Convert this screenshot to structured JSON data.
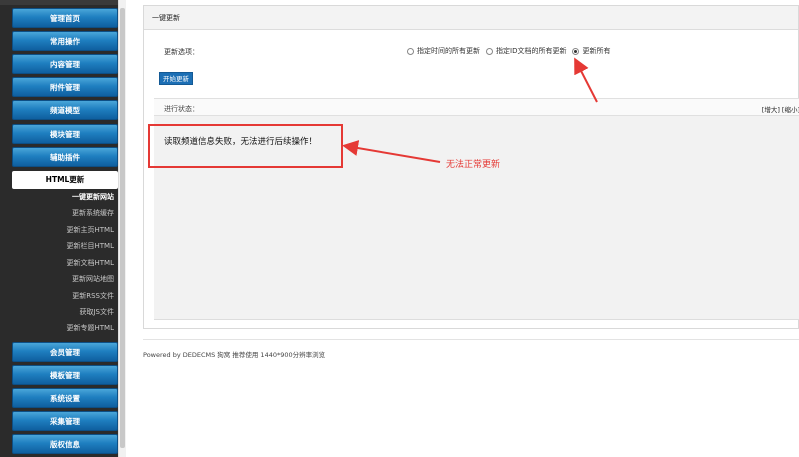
{
  "sidebar": {
    "buttons": {
      "home": "管理首页",
      "common": "常用操作",
      "content": "内容管理",
      "attach": "附件管理",
      "channel": "频道模型",
      "module": "模块管理",
      "plugin": "辅助插件",
      "member": "会员管理",
      "template": "模板管理",
      "system": "系统设置",
      "collect": "采集管理",
      "copyright": "版权信息"
    },
    "active": "HTML更新",
    "subitems": [
      "一键更新网站",
      "更新系统缓存",
      "更新主页HTML",
      "更新栏目HTML",
      "更新文档HTML",
      "更新网站地图",
      "更新RSS文件",
      "获取JS文件",
      "更新专题HTML"
    ]
  },
  "panel": {
    "title": "一键更新",
    "options_label": "更新选项：",
    "options": [
      {
        "label": "指定时间的所有更新",
        "selected": false
      },
      {
        "label": "指定ID文档的所有更新",
        "selected": false
      },
      {
        "label": "更新所有",
        "selected": true
      }
    ],
    "start_button": "开始更新",
    "progress_label": "进行状态：",
    "progress_tools": "[增大] [缩小]",
    "status_message": "读取频道信息失败，无法进行后续操作！"
  },
  "annotation": {
    "text": "无法正常更新",
    "color": "#e53935"
  },
  "footer": "Powered by DEDECMS 狗窝 推荐使用 1440*900分辨率浏览",
  "colors": {
    "sidebar_bg": "#2b2b2b",
    "button_blue": "#1f7fc0",
    "annotation_red": "#e53935"
  }
}
